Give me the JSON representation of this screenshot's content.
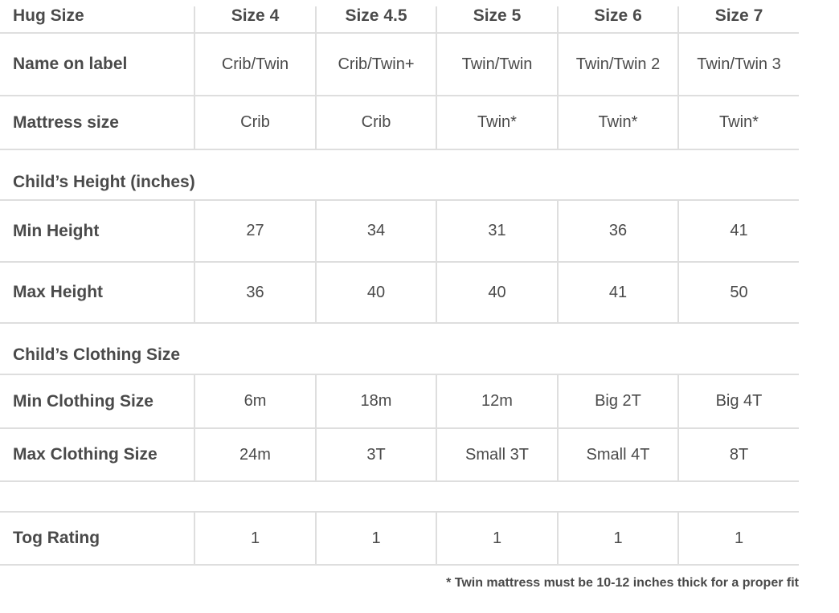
{
  "table": {
    "header": {
      "label": "Hug Size",
      "columns": [
        "Size 4",
        "Size 4.5",
        "Size 5",
        "Size 6",
        "Size 7"
      ]
    },
    "rows_top": [
      {
        "label": "Name on label",
        "values": [
          "Crib/Twin",
          "Crib/Twin+",
          "Twin/Twin",
          "Twin/Twin 2",
          "Twin/Twin 3"
        ]
      },
      {
        "label": "Mattress size",
        "values": [
          "Crib",
          "Crib",
          "Twin*",
          "Twin*",
          "Twin*"
        ]
      }
    ],
    "section_height": {
      "title": "Child’s Height (inches)",
      "rows": [
        {
          "label": "Min Height",
          "values": [
            "27",
            "34",
            "31",
            "36",
            "41"
          ]
        },
        {
          "label": "Max Height",
          "values": [
            "36",
            "40",
            "40",
            "41",
            "50"
          ]
        }
      ]
    },
    "section_clothing": {
      "title": "Child’s Clothing Size",
      "rows": [
        {
          "label": "Min Clothing Size",
          "values": [
            "6m",
            "18m",
            "12m",
            "Big 2T",
            "Big 4T"
          ]
        },
        {
          "label": "Max Clothing Size",
          "values": [
            "24m",
            "3T",
            "Small 3T",
            "Small 4T",
            "8T"
          ]
        }
      ]
    },
    "tog": {
      "label": "Tog Rating",
      "values": [
        "1",
        "1",
        "1",
        "1",
        "1"
      ]
    }
  },
  "footnote": "* Twin mattress must be 10-12 inches thick for a proper fit"
}
